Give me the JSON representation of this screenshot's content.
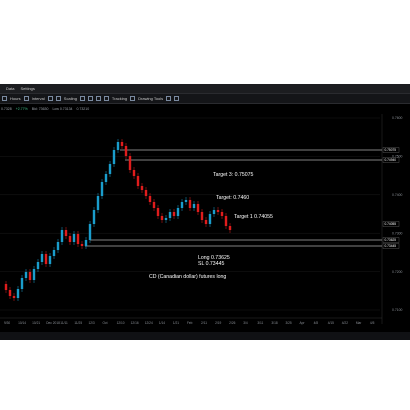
{
  "menubar": {
    "items": [
      "Data",
      "Settings"
    ]
  },
  "toolbar": {
    "items": [
      "Hours",
      "Interval",
      "Scaling",
      "Tracking",
      "Drawing Tools"
    ]
  },
  "infobar": {
    "price": "0.7328",
    "bid": "Bid: 73630",
    "low": "Low 0.73134",
    "high": "0.73210",
    "change": "+2.77%"
  },
  "chart": {
    "annotations": [
      {
        "id": "target3",
        "text": "Target 3: 0.75075"
      },
      {
        "id": "target2",
        "text": "Target: 0.7460"
      },
      {
        "id": "target1",
        "text": "Target 1 0.74055"
      },
      {
        "id": "entry",
        "text": "Long 0.73625"
      },
      {
        "id": "stop",
        "text": "SL 0.73445"
      },
      {
        "id": "caption",
        "text": "CD (Canadian dollar) futures long"
      }
    ],
    "price_tags": [
      "0.75075",
      "0.74940",
      "0.74055",
      "0.73625",
      "0.73445"
    ],
    "price_axis": [
      "0.7600",
      "0.7500",
      "0.7400",
      "0.7300",
      "0.7200",
      "0.7100"
    ],
    "x_labels": [
      "9/30",
      "10/14",
      "10/21",
      "Dec 2018",
      "11/11",
      "11/25",
      "12/3",
      "Oct",
      "12/10",
      "12/16",
      "12/24",
      "1/14",
      "1/21",
      "Feb",
      "2/11",
      "2/19",
      "2/26",
      "3/4",
      "3/11",
      "3/18",
      "3/25",
      "Apr",
      "4/8",
      "4/15",
      "4/22",
      "Mar",
      "4/5"
    ],
    "colors": {
      "up": "#1a9dcc",
      "down": "#e01c1c",
      "background": "#000000",
      "level_line": "#ffffff"
    }
  }
}
